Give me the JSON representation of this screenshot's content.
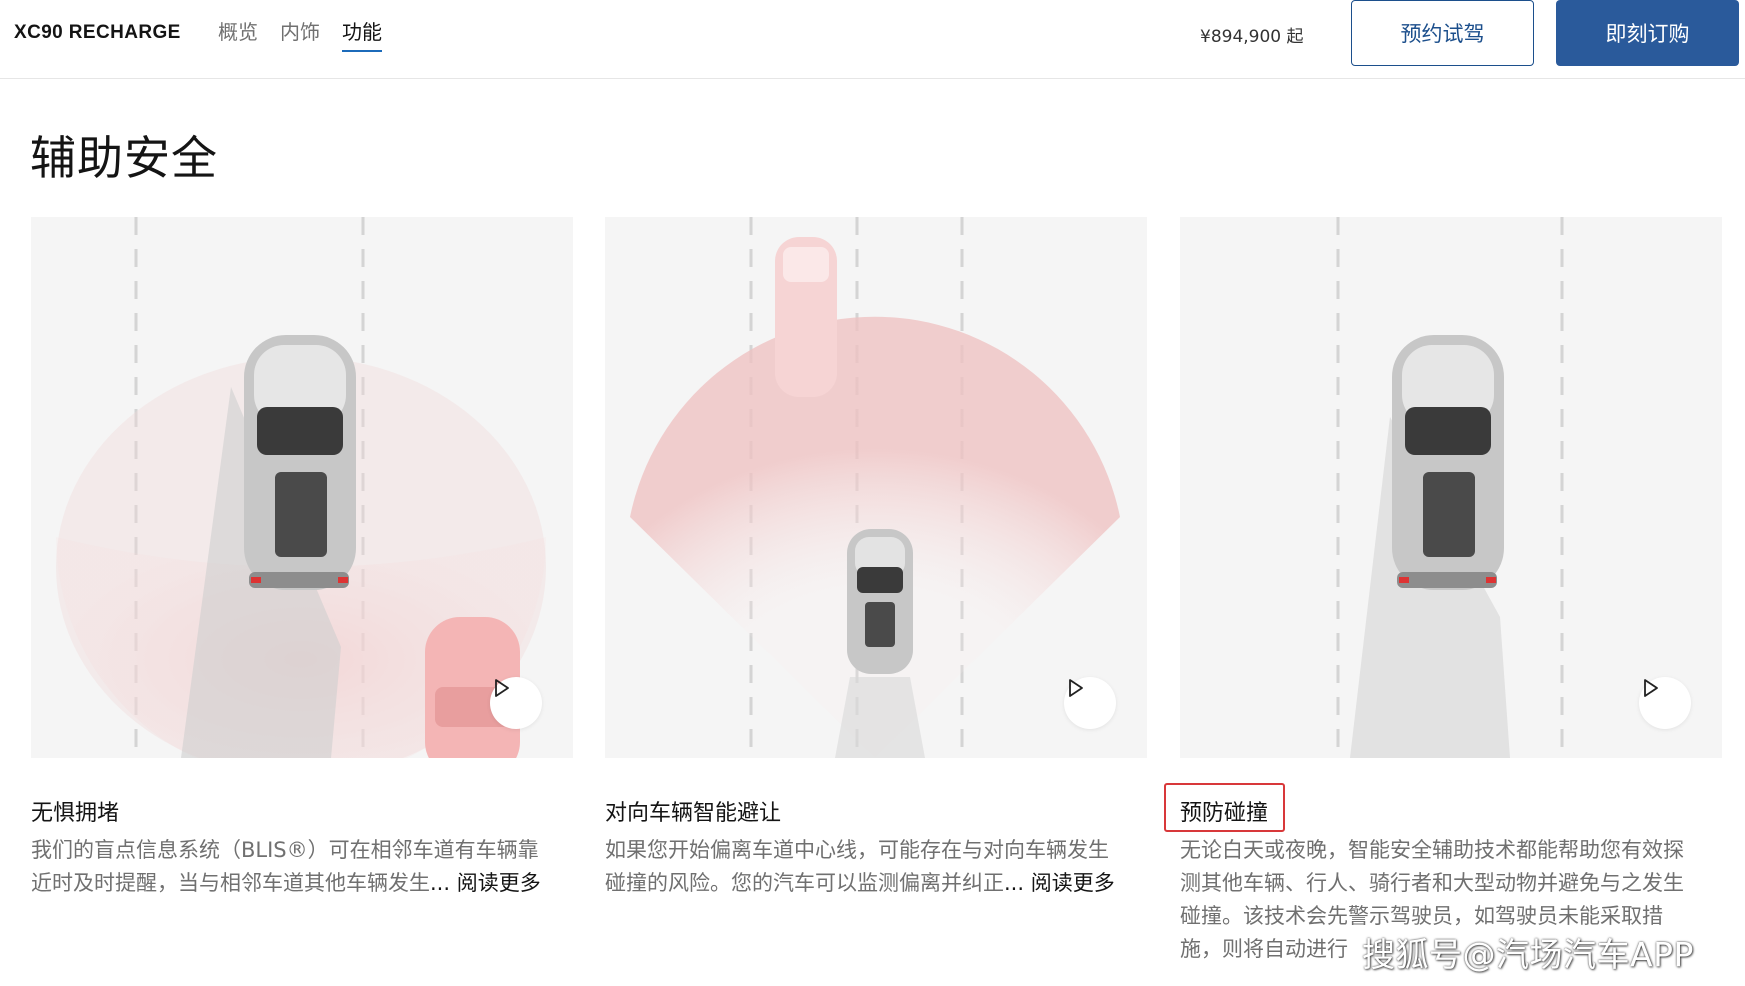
{
  "header": {
    "brand": "XC90 RECHARGE",
    "nav": [
      "概览",
      "内饰",
      "功能"
    ],
    "active_nav": "功能",
    "price": "¥894,900 起",
    "test_drive_label": "预约试驾",
    "order_label": "即刻订购"
  },
  "section": {
    "title": "辅助安全",
    "cards": [
      {
        "title": "无惧拥堵",
        "desc_line1": "我们的盲点信息系统（BLIS®）可在相邻车道有车辆靠",
        "desc_line2": "近时及时提醒，当与相邻车道其他车辆发生",
        "read_more": "... 阅读更多"
      },
      {
        "title": "对向车辆智能避让",
        "desc_line1": "如果您开始偏离车道中心线，可能存在与对向车辆发生",
        "desc_line2": "碰撞的风险。您的汽车可以监测偏离并纠正",
        "read_more": "... 阅读更多"
      },
      {
        "title": "预防碰撞",
        "desc_line1": "无论白天或夜晚，智能安全辅助技术都能帮助您有效探",
        "desc_line2": "测其他车辆、行人、骑行者和大型动物并避免与之发生",
        "desc_line3": "碰撞。该技术会先警示驾驶员，如驾驶员未能采取措",
        "desc_line4": "施，则将自动进行"
      }
    ]
  },
  "watermark": "搜狐号@汽场汽车APP",
  "colors": {
    "accent": "#2a5a9b",
    "nav_underline": "#1c6bba",
    "highlight": "#d8383a",
    "text_muted": "#707070"
  }
}
